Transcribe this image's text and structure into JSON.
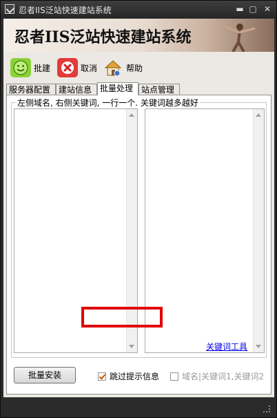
{
  "window": {
    "title": "忍者IIS泛站快速建站系统",
    "banner_title": "忍者IIS泛站快速建站系统",
    "controls": {
      "minimize": "▬",
      "maximize": "▢",
      "close": "✕"
    }
  },
  "toolbar": {
    "build": {
      "label": "批建",
      "icon": "smiley-icon",
      "color": "#7bc42b"
    },
    "cancel": {
      "label": "取消",
      "icon": "cancel-x-icon",
      "color": "#d42323"
    },
    "help": {
      "label": "帮助",
      "icon": "house-help-icon",
      "color": "#e2a23a"
    }
  },
  "tabs": [
    {
      "label": "服务器配置",
      "active": false
    },
    {
      "label": "建站信息",
      "active": false
    },
    {
      "label": "批量处理",
      "active": true
    },
    {
      "label": "站点管理",
      "active": false
    }
  ],
  "batch": {
    "group_label": "左侧域名, 右侧关键词, 一行一个. 关键词越多越好",
    "domains_value": "",
    "keywords_value": "",
    "keyword_tool_link": "关键词工具",
    "install_button": "批量安装",
    "skip_prompt_label": "跳过提示信息",
    "skip_prompt_checked": true,
    "domain_keyword_label": "域名|关键词1,关键词2",
    "domain_keyword_checked": false
  }
}
